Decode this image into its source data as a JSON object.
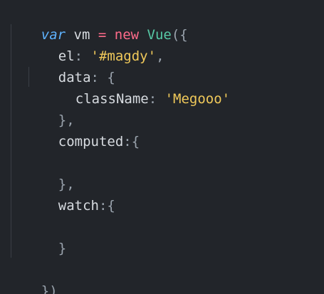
{
  "code": {
    "line1": {
      "kw_var": "var",
      "name": " vm ",
      "eq": "=",
      "kw_new": " new ",
      "cls": "Vue",
      "open": "({"
    },
    "line2": {
      "key": "el",
      "colon": ": ",
      "value": "'#magdy'",
      "comma": ","
    },
    "line3": {
      "key": "data",
      "colon": ": ",
      "brace": "{"
    },
    "line4": {
      "key": "className",
      "colon": ": ",
      "value": "'Megooo'"
    },
    "line5": {
      "close": "},"
    },
    "line6": {
      "key": "computed",
      "colon": ":",
      "brace": "{"
    },
    "line8": {
      "close": "},"
    },
    "line9": {
      "key": "watch",
      "colon": ":",
      "brace": "{"
    },
    "line11": {
      "close": "}"
    },
    "line13": {
      "close": "})"
    }
  },
  "colors": {
    "background": "#22252a",
    "keyword": "#5fb3ff",
    "operator": "#ff6b8a",
    "class": "#57c9a6",
    "string": "#f0c95a",
    "punctuation": "#9aa3ad",
    "text": "#d7dbe0"
  }
}
